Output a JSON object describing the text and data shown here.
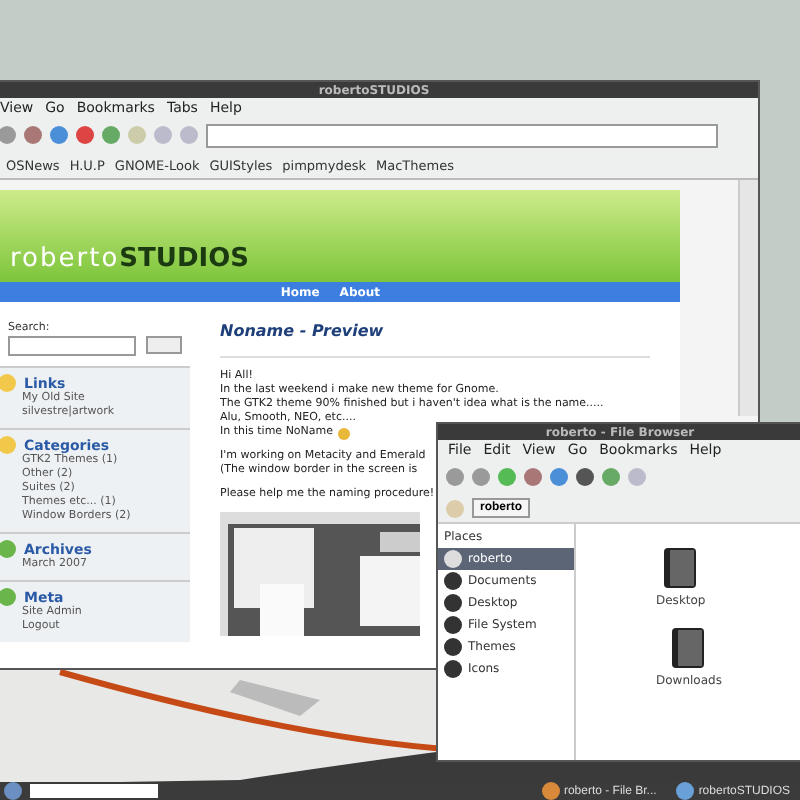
{
  "browser": {
    "title": "robertoSTUDIOS",
    "menu": [
      "View",
      "Go",
      "Bookmarks",
      "Tabs",
      "Help"
    ],
    "bookmarks": [
      "OSNews",
      "H.U.P",
      "GNOME-Look",
      "GUIStyles",
      "pimpmydesk",
      "MacThemes"
    ],
    "site": {
      "logo_light": "roberto",
      "logo_bold": "STUDIOS",
      "nav": [
        "Home",
        "About"
      ],
      "search_label": "Search:",
      "sections": [
        {
          "title": "Links",
          "items": [
            "My Old Site",
            "silvestre|artwork"
          ]
        },
        {
          "title": "Categories",
          "items": [
            "GTK2 Themes (1)",
            "Other (2)",
            "Suites (2)",
            "Themes etc... (1)",
            "Window Borders (2)"
          ]
        },
        {
          "title": "Archives",
          "items": [
            "March 2007"
          ]
        },
        {
          "title": "Meta",
          "items": [
            "Site Admin",
            "Logout"
          ]
        }
      ],
      "post_title": "Noname - Preview",
      "paragraphs": [
        [
          "Hi All!",
          "In the last weekend i make new theme for Gnome.",
          "The GTK2 theme 90% finished but i haven't idea what is the name.....",
          "Alu, Smooth, NEO, etc....",
          "In this time NoName"
        ],
        [
          "I'm working on Metacity and Emerald",
          "(The window border in the screen is"
        ],
        [
          "Please help me the naming procedure!"
        ]
      ]
    }
  },
  "file_browser": {
    "title": "roberto - File Browser",
    "menu": [
      "File",
      "Edit",
      "View",
      "Go",
      "Bookmarks",
      "Help"
    ],
    "location": "roberto",
    "places_header": "Places",
    "places": [
      {
        "label": "roberto",
        "selected": true
      },
      {
        "label": "Documents",
        "selected": false
      },
      {
        "label": "Desktop",
        "selected": false
      },
      {
        "label": "File System",
        "selected": false
      },
      {
        "label": "Themes",
        "selected": false
      },
      {
        "label": "Icons",
        "selected": false
      }
    ],
    "files": [
      "Desktop",
      "Downloads"
    ]
  },
  "taskbar": {
    "tasks": [
      {
        "label": "roberto - File Br...",
        "kind": "files"
      },
      {
        "label": "robertoSTUDIOS",
        "kind": "web"
      }
    ]
  }
}
